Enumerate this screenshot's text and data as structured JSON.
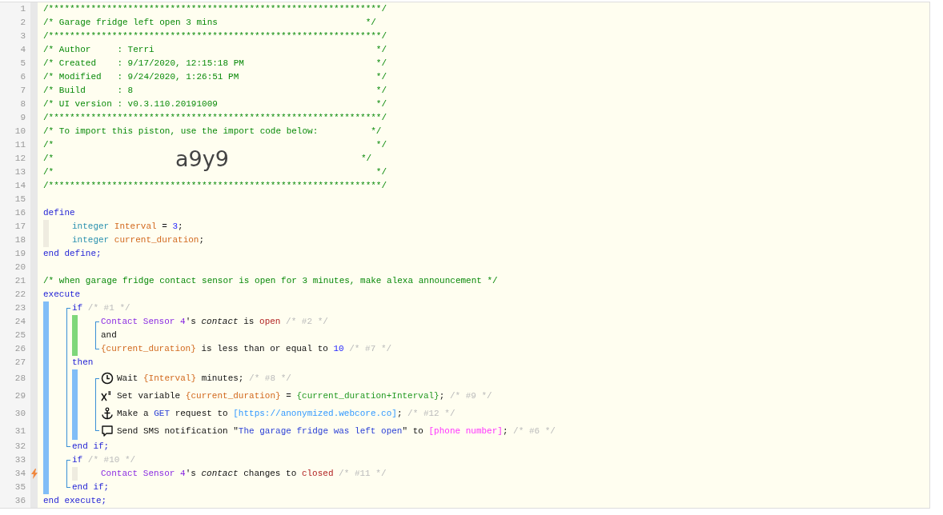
{
  "lines": [
    {
      "number": "1",
      "kind": "code",
      "tokens": [
        {
          "kind": "comment",
          "text": "/***************************************************************/"
        }
      ]
    },
    {
      "number": "2",
      "kind": "code",
      "tokens": [
        {
          "kind": "comment",
          "text": "/* Garage fridge left open 3 mins                            */"
        }
      ]
    },
    {
      "number": "3",
      "kind": "code",
      "tokens": [
        {
          "kind": "comment",
          "text": "/***************************************************************/"
        }
      ]
    },
    {
      "number": "4",
      "kind": "code",
      "tokens": [
        {
          "kind": "comment",
          "text": "/* Author     : Terri                                          */"
        }
      ]
    },
    {
      "number": "5",
      "kind": "code",
      "tokens": [
        {
          "kind": "comment",
          "text": "/* Created    : 9/17/2020, 12:15:18 PM                         */"
        }
      ]
    },
    {
      "number": "6",
      "kind": "code",
      "tokens": [
        {
          "kind": "comment",
          "text": "/* Modified   : 9/24/2020, 1:26:51 PM                          */"
        }
      ]
    },
    {
      "number": "7",
      "kind": "code",
      "tokens": [
        {
          "kind": "comment",
          "text": "/* Build      : 8                                              */"
        }
      ]
    },
    {
      "number": "8",
      "kind": "code",
      "tokens": [
        {
          "kind": "comment",
          "text": "/* UI version : v0.3.110.20191009                              */"
        }
      ]
    },
    {
      "number": "9",
      "kind": "code",
      "tokens": [
        {
          "kind": "comment",
          "text": "/***************************************************************/"
        }
      ]
    },
    {
      "number": "10",
      "kind": "code",
      "tokens": [
        {
          "kind": "comment",
          "text": "/* To import this piston, use the import code below:          */"
        }
      ]
    },
    {
      "number": "11",
      "kind": "code",
      "tokens": [
        {
          "kind": "comment",
          "text": "/*                                                             */"
        }
      ]
    },
    {
      "number": "12",
      "kind": "code",
      "tokens": [
        {
          "kind": "comment",
          "text": "/*                       "
        },
        {
          "kind": "import-code",
          "text": "a9y9"
        },
        {
          "kind": "comment",
          "text": "                         */"
        }
      ]
    },
    {
      "number": "13",
      "kind": "code",
      "tokens": [
        {
          "kind": "comment",
          "text": "/*                                                             */"
        }
      ]
    },
    {
      "number": "14",
      "kind": "code",
      "tokens": [
        {
          "kind": "comment",
          "text": "/***************************************************************/"
        }
      ]
    },
    {
      "number": "15",
      "kind": "code"
    },
    {
      "number": "16",
      "kind": "code",
      "tokens": [
        {
          "kind": "keyword",
          "text": "define"
        }
      ]
    },
    {
      "number": "17",
      "kind": "code",
      "slots": [
        {
          "kind": "define"
        }
      ],
      "tokens": [
        {
          "kind": "type",
          "text": "integer "
        },
        {
          "kind": "variable",
          "text": "Interval"
        },
        {
          "kind": "plain",
          "text": " = "
        },
        {
          "kind": "number",
          "text": "3"
        },
        {
          "kind": "plain",
          "text": ";"
        }
      ]
    },
    {
      "number": "18",
      "kind": "code",
      "slots": [
        {
          "kind": "define"
        }
      ],
      "tokens": [
        {
          "kind": "type",
          "text": "integer "
        },
        {
          "kind": "variable",
          "text": "current_duration"
        },
        {
          "kind": "plain",
          "text": ";"
        }
      ]
    },
    {
      "number": "19",
      "kind": "code",
      "tokens": [
        {
          "kind": "keyword",
          "text": "end define;"
        }
      ]
    },
    {
      "number": "20",
      "kind": "code"
    },
    {
      "number": "21",
      "kind": "code",
      "tokens": [
        {
          "kind": "comment",
          "text": "/* when garage fridge contact sensor is open for 3 minutes, make alexa announcement */"
        }
      ]
    },
    {
      "number": "22",
      "kind": "code",
      "tokens": [
        {
          "kind": "keyword",
          "text": "execute"
        }
      ]
    },
    {
      "number": "23",
      "kind": "code",
      "slots": [
        {
          "kind": "execute",
          "bracket": {
            "kind": "open"
          }
        }
      ],
      "tokens": [
        {
          "kind": "keyword",
          "text": "if "
        },
        {
          "kind": "note",
          "text": "/* #1 */"
        }
      ]
    },
    {
      "number": "24",
      "kind": "code",
      "slots": [
        {
          "kind": "execute",
          "bracket": {
            "kind": "mid"
          }
        },
        {
          "kind": "condition",
          "bracket": {
            "kind": "open"
          }
        }
      ],
      "tokens": [
        {
          "kind": "device",
          "text": "Contact Sensor 4"
        },
        {
          "kind": "plain",
          "text": "'s "
        },
        {
          "kind": "attribute",
          "text": "contact"
        },
        {
          "kind": "plain",
          "text": " is "
        },
        {
          "kind": "value",
          "text": "open"
        },
        {
          "kind": "note",
          "text": " /* #2 */"
        }
      ]
    },
    {
      "number": "25",
      "kind": "code",
      "slots": [
        {
          "kind": "execute",
          "bracket": {
            "kind": "mid"
          }
        },
        {
          "kind": "condition",
          "bracket": {
            "kind": "mid"
          }
        }
      ],
      "tokens": [
        {
          "kind": "plain",
          "text": "and"
        }
      ]
    },
    {
      "number": "26",
      "kind": "code",
      "slots": [
        {
          "kind": "execute",
          "bracket": {
            "kind": "mid"
          }
        },
        {
          "kind": "condition",
          "bracket": {
            "kind": "close"
          }
        }
      ],
      "tokens": [
        {
          "kind": "variable",
          "text": "{current_duration}"
        },
        {
          "kind": "plain",
          "text": " is less than or equal to "
        },
        {
          "kind": "number",
          "text": "10"
        },
        {
          "kind": "note",
          "text": " /* #7 */"
        }
      ]
    },
    {
      "number": "27",
      "kind": "code",
      "slots": [
        {
          "kind": "execute",
          "bracket": {
            "kind": "mid"
          }
        }
      ],
      "tokens": [
        {
          "kind": "keyword",
          "text": "then"
        }
      ]
    },
    {
      "number": "28",
      "kind": "wait",
      "slots": [
        {
          "kind": "execute",
          "bracket": {
            "kind": "mid"
          }
        },
        {
          "kind": "then",
          "bracket": {
            "kind": "open"
          }
        }
      ],
      "tokens": [
        {
          "kind": "plain",
          "text": "Wait "
        },
        {
          "kind": "variable",
          "text": "{Interval}"
        },
        {
          "kind": "plain",
          "text": " minutes; "
        },
        {
          "kind": "note",
          "text": "/* #8 */"
        }
      ]
    },
    {
      "number": "29",
      "kind": "assign",
      "slots": [
        {
          "kind": "execute",
          "bracket": {
            "kind": "mid"
          }
        },
        {
          "kind": "then",
          "bracket": {
            "kind": "mid"
          }
        }
      ],
      "tokens": [
        {
          "kind": "plain",
          "text": "Set variable "
        },
        {
          "kind": "variable",
          "text": "{current_duration}"
        },
        {
          "kind": "plain",
          "text": " = "
        },
        {
          "kind": "expression",
          "text": "{current_duration+Interval}"
        },
        {
          "kind": "plain",
          "text": "; "
        },
        {
          "kind": "note",
          "text": "/* #9 */"
        }
      ]
    },
    {
      "number": "30",
      "kind": "request",
      "slots": [
        {
          "kind": "execute",
          "bracket": {
            "kind": "mid"
          }
        },
        {
          "kind": "then",
          "bracket": {
            "kind": "mid"
          }
        }
      ],
      "tokens": [
        {
          "kind": "plain",
          "text": "Make a "
        },
        {
          "kind": "string",
          "text": "GET"
        },
        {
          "kind": "plain",
          "text": " request to "
        },
        {
          "kind": "url",
          "text": "[https://anonymized.webcore.co]"
        },
        {
          "kind": "plain",
          "text": "; "
        },
        {
          "kind": "note",
          "text": "/* #12 */"
        }
      ]
    },
    {
      "number": "31",
      "kind": "notify",
      "slots": [
        {
          "kind": "execute",
          "bracket": {
            "kind": "mid"
          }
        },
        {
          "kind": "then",
          "bracket": {
            "kind": "close"
          }
        }
      ],
      "tokens": [
        {
          "kind": "plain",
          "text": "Send SMS notification \""
        },
        {
          "kind": "string",
          "text": "The garage fridge was left open"
        },
        {
          "kind": "plain",
          "text": "\" to "
        },
        {
          "kind": "phone",
          "text": "[phone number]"
        },
        {
          "kind": "plain",
          "text": "; "
        },
        {
          "kind": "note",
          "text": "/* #6 */"
        }
      ]
    },
    {
      "number": "32",
      "kind": "code",
      "slots": [
        {
          "kind": "execute",
          "bracket": {
            "kind": "close"
          }
        }
      ],
      "tokens": [
        {
          "kind": "keyword",
          "text": "end if;"
        }
      ]
    },
    {
      "number": "33",
      "kind": "code",
      "slots": [
        {
          "kind": "execute",
          "bracket": {
            "kind": "open"
          }
        }
      ],
      "tokens": [
        {
          "kind": "keyword",
          "text": "if "
        },
        {
          "kind": "note",
          "text": "/* #10 */"
        }
      ]
    },
    {
      "number": "34",
      "kind": "code",
      "trigger": true,
      "slots": [
        {
          "kind": "execute",
          "bracket": {
            "kind": "mid"
          }
        },
        {
          "kind": "define"
        }
      ],
      "tokens": [
        {
          "kind": "device",
          "text": "Contact Sensor 4"
        },
        {
          "kind": "plain",
          "text": "'s "
        },
        {
          "kind": "attribute",
          "text": "contact"
        },
        {
          "kind": "plain",
          "text": " changes to "
        },
        {
          "kind": "value",
          "text": "closed"
        },
        {
          "kind": "note",
          "text": " /* #11 */"
        }
      ]
    },
    {
      "number": "35",
      "kind": "code",
      "slots": [
        {
          "kind": "execute",
          "bracket": {
            "kind": "close"
          }
        }
      ],
      "tokens": [
        {
          "kind": "keyword",
          "text": "end if;"
        }
      ]
    },
    {
      "number": "36",
      "kind": "code",
      "tokens": [
        {
          "kind": "keyword",
          "text": "end execute;"
        }
      ]
    }
  ]
}
